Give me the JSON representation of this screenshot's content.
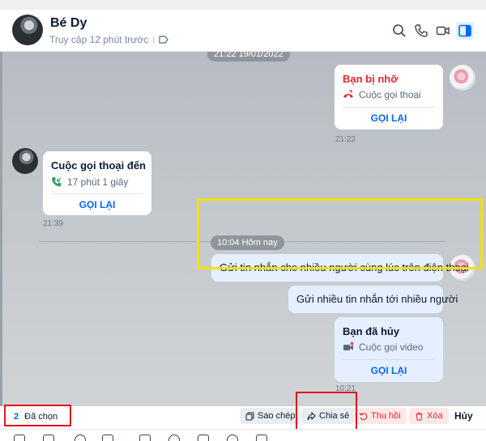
{
  "header": {
    "contact_name": "Bé Dy",
    "status": "Truy cập 12 phút trước",
    "icons": [
      "search-icon",
      "phone-icon",
      "video-call-icon",
      "sidebar-toggle-icon"
    ]
  },
  "messages": {
    "top_time_pill": "21:22 19/01/2022",
    "missed_call": {
      "title": "Bạn bị nhỡ",
      "subtitle": "Cuộc gọi thoại",
      "action": "GỌI LẠI",
      "time": "21:22"
    },
    "incoming_call": {
      "title": "Cuộc gọi thoại đến",
      "subtitle": "17 phút 1 giây",
      "action": "GỌI LẠI",
      "time": "21:39"
    },
    "day_divider": "10:04 Hôm nay",
    "text_1": "Gửi tin nhắn cho nhiều người cùng lúc trên điện thoại",
    "text_2": "Gửi nhiều tin nhắn tới nhiều người",
    "cancelled_video": {
      "title": "Bạn đã hủy",
      "subtitle": "Cuộc gọi video",
      "action": "GỌI LẠI",
      "time": "10:21"
    }
  },
  "selection_bar": {
    "count": "2",
    "selected_label": "Đã chọn",
    "copy_label": "Sao chép",
    "share_label": "Chia sẻ",
    "recall_label": "Thu hồi",
    "delete_label": "Xóa",
    "cancel_label": "Hủy"
  },
  "colors": {
    "accent": "#0068ff",
    "danger": "#e0282e",
    "highlight_yellow": "#f5e000",
    "annotation_red": "#e0141b"
  }
}
